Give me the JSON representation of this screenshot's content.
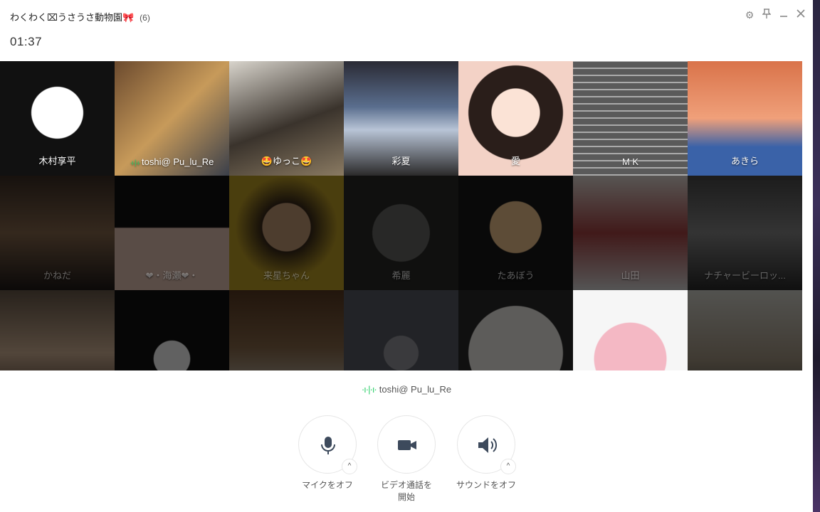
{
  "window": {
    "title": "わくわく⌧うさうさ動物園🎀",
    "participant_count": "(6)",
    "timer": "01:37"
  },
  "titlebar_icons": [
    "gear-icon",
    "pin-icon",
    "minimize-icon",
    "close-icon"
  ],
  "tiles": [
    {
      "name": "木村享平",
      "speaking": false,
      "dim": false
    },
    {
      "name": "toshi@ Pu_lu_Re",
      "speaking": true,
      "dim": false
    },
    {
      "name": "🤩ゆっこ🤩",
      "speaking": false,
      "dim": false
    },
    {
      "name": "彩夏",
      "speaking": false,
      "dim": false
    },
    {
      "name": "愛",
      "speaking": false,
      "dim": false
    },
    {
      "name": "M K",
      "speaking": false,
      "dim": false
    },
    {
      "name": "あきら",
      "speaking": false,
      "dim": false
    },
    {
      "name": "かねだ",
      "speaking": false,
      "dim": true
    },
    {
      "name": "❤・海瀬❤・",
      "speaking": false,
      "dim": true
    },
    {
      "name": "来星ちゃん",
      "speaking": false,
      "dim": true
    },
    {
      "name": "希麗",
      "speaking": false,
      "dim": true
    },
    {
      "name": "たあぼう",
      "speaking": false,
      "dim": true
    },
    {
      "name": "山田",
      "speaking": false,
      "dim": true
    },
    {
      "name": "ナチャービーロッ...",
      "speaking": false,
      "dim": true
    },
    {
      "name": "",
      "speaking": false,
      "dim": true
    },
    {
      "name": "",
      "speaking": false,
      "dim": true
    },
    {
      "name": "",
      "speaking": false,
      "dim": true
    },
    {
      "name": "",
      "speaking": false,
      "dim": true
    },
    {
      "name": "",
      "speaking": false,
      "dim": true
    },
    {
      "name": "",
      "speaking": false,
      "dim": false
    },
    {
      "name": "",
      "speaking": false,
      "dim": true
    }
  ],
  "active_speaker": "toshi@ Pu_lu_Re",
  "controls": {
    "mic": {
      "label": "マイクをオフ",
      "icon": "microphone-icon"
    },
    "video": {
      "label": "ビデオ通話を開始",
      "icon": "video-camera-icon"
    },
    "sound": {
      "label": "サウンドをオフ",
      "icon": "speaker-icon"
    }
  },
  "colors": {
    "speaking": "#2ecf6a",
    "grid_bg": "#111111"
  }
}
